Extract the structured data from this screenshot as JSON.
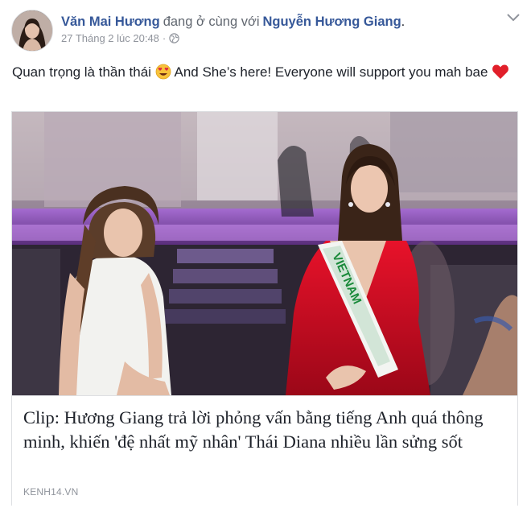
{
  "post": {
    "author": "Văn Mai Hương",
    "with_text": "đang ở cùng với",
    "tagged": "Nguyễn Hương Giang",
    "period": ".",
    "timestamp": "27 Tháng 2 lúc 20:48",
    "separator": "·",
    "privacy_icon": "globe-icon",
    "message_part1": "Quan trọng là thần thái",
    "message_emoji1": "heart-eyes-emoji",
    "message_part2": "And She’s here! Everyone will support you mah bae",
    "message_emoji2": "red-heart-emoji"
  },
  "link_card": {
    "title": "Clip: Hương Giang trả lời phỏng vấn bằng tiếng Anh quá thông minh, khiến 'đệ nhất mỹ nhân' Thái Diana nhiều lần sửng sốt",
    "domain": "KENH14.VN",
    "sash_text": "VIETNAM"
  },
  "colors": {
    "link": "#365899",
    "meta": "#90949c",
    "text": "#1d2129",
    "border": "#dddfe2"
  }
}
